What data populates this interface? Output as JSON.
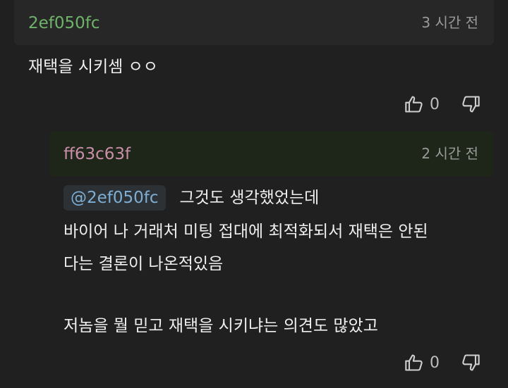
{
  "comment": {
    "username": "2ef050fc",
    "timestamp": "3 시간 전",
    "text": "재택을 시키셈 ㅇㅇ",
    "like_count": "0"
  },
  "reply": {
    "username": "ff63c63f",
    "timestamp": "2 시간 전",
    "mention": "@2ef050fc",
    "line1": "그것도 생각했었는데",
    "line2": "바이어 나 거래처 미팅 접대에 최적화되서 재택은 안된",
    "line3": "다는 결론이 나온적있음",
    "line4": "저놈을 뭘 믿고 재택을 시키냐는 의견도 많았고",
    "like_count": "0"
  },
  "colors": {
    "background": "#202020",
    "comment_username": "#6fb36a",
    "reply_username": "#c98fa8",
    "mention_text": "#7eaed4"
  },
  "icons": [
    "thumbs-up-icon",
    "thumbs-down-icon"
  ]
}
